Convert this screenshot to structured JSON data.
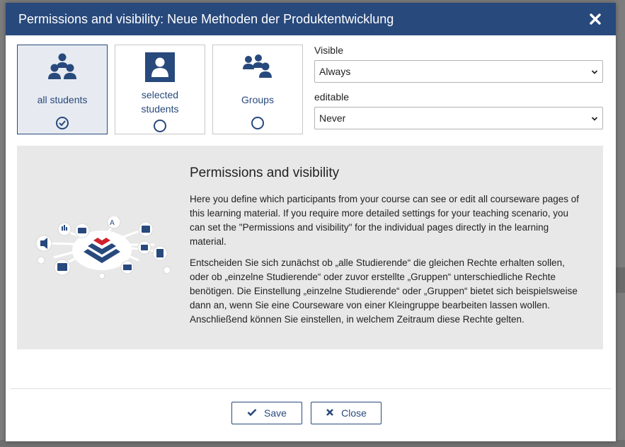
{
  "dialog": {
    "title": "Permissions and visibility: Neue Methoden der Produktentwicklung"
  },
  "audience_options": [
    {
      "label": "all students",
      "selected": true,
      "icon": "group-icon"
    },
    {
      "label": "selected students",
      "selected": false,
      "icon": "user-icon"
    },
    {
      "label": "Groups",
      "selected": false,
      "icon": "groups-icon"
    }
  ],
  "visible": {
    "label": "Visible",
    "value": "Always"
  },
  "editable": {
    "label": "editable",
    "value": "Never"
  },
  "info": {
    "heading": "Permissions and visibility",
    "paragraph1": "Here you define which participants from your course can see or edit all courseware pages of this learning material. If you require more detailed settings for your teaching scenario, you can set the \"Permissions and visibility\" for the individual pages directly in the learning material.",
    "paragraph2": "Entscheiden Sie sich zunächst ob „alle Studierende“ die gleichen Rechte erhalten sollen, oder ob „einzelne Studierende“ oder zuvor erstellte „Gruppen“ unterschiedliche Rechte benötigen. Die Einstellung „einzelne Studierende“ oder „Gruppen“ bietet sich beispielsweise dann an, wenn Sie eine Courseware von einer Kleingruppe bearbeiten lassen wollen. Anschließend können Sie einstellen, in welchem Zeitraum diese Rechte gelten."
  },
  "buttons": {
    "save": "Save",
    "close": "Close"
  },
  "colors": {
    "primary": "#28497c",
    "accent_red": "#d0222b",
    "panel_bg": "#e8e8e8"
  }
}
